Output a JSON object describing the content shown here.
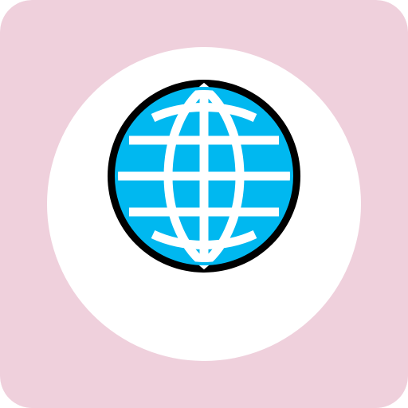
{
  "icon": {
    "name": "globe-icon",
    "colors": {
      "tile_background": "#efd0dc",
      "circle_background": "#ffffff",
      "globe_fill": "#00b8f0",
      "globe_outline": "#000000",
      "grid_lines": "#ffffff"
    }
  }
}
